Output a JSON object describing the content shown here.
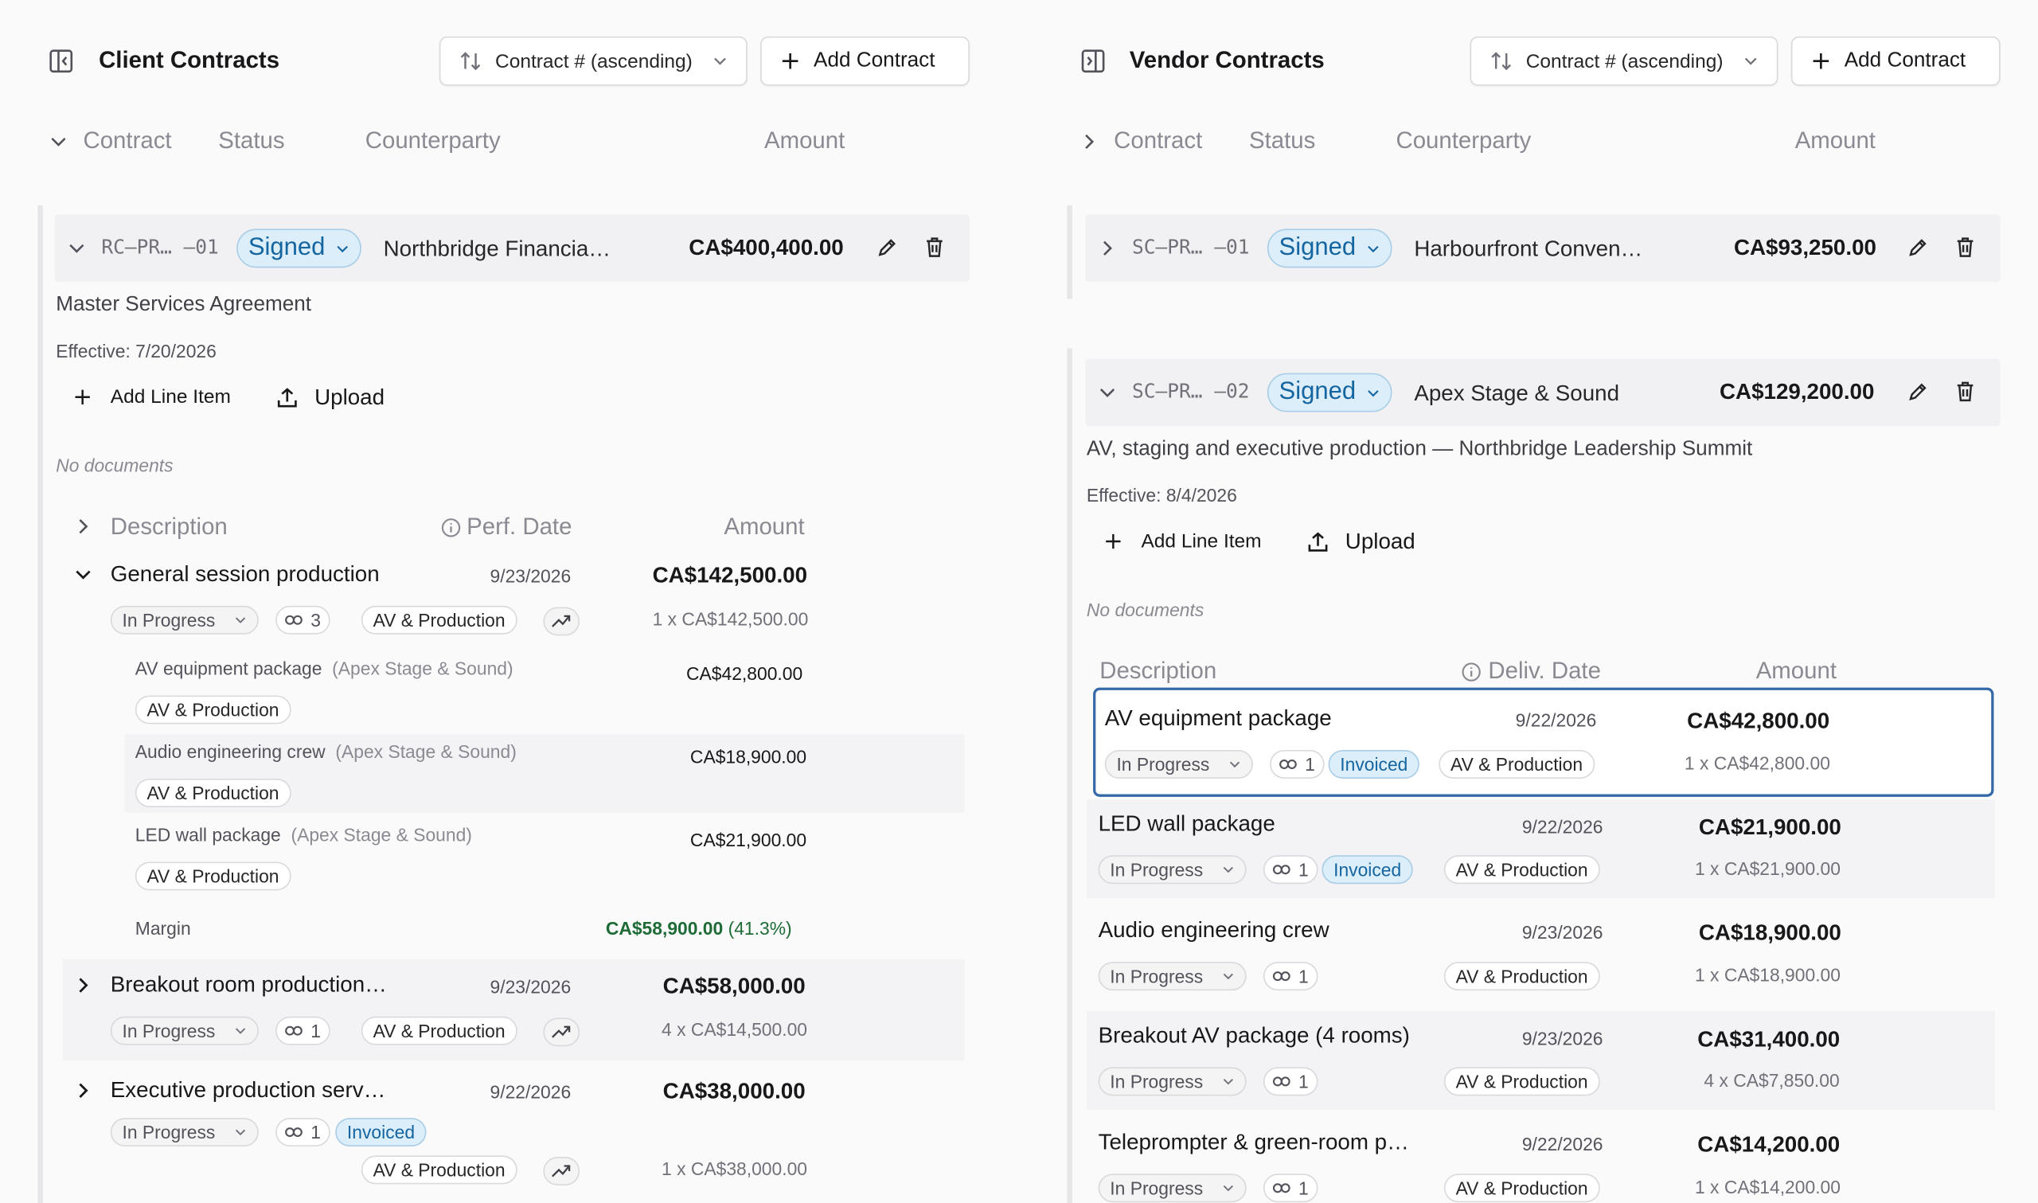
{
  "client": {
    "title": "Client Contracts",
    "sort_label": "Contract # (ascending)",
    "add_label": "Add Contract",
    "columns": {
      "contract": "Contract",
      "status": "Status",
      "counterparty": "Counterparty",
      "amount": "Amount"
    },
    "contract": {
      "number": "RC–PR… –01",
      "status": "Signed",
      "counterparty": "Northbridge Financia…",
      "amount": "CA$400,400.00",
      "description": "Master Services Agreement",
      "effective": "Effective: 7/20/2026",
      "add_line_item": "Add Line Item",
      "upload": "Upload",
      "no_documents": "No documents",
      "li_columns": {
        "description": "Description",
        "date": "Perf. Date",
        "amount": "Amount"
      },
      "line_items": [
        {
          "title": "General session production",
          "date": "9/23/2026",
          "amount": "CA$142,500.00",
          "status": "In Progress",
          "links": "3",
          "category": "AV & Production",
          "qty": "1 x CA$142,500.00",
          "children": [
            {
              "title": "AV equipment package",
              "vendor": "(Apex Stage & Sound)",
              "amount": "CA$42,800.00",
              "category": "AV & Production"
            },
            {
              "title": "Audio engineering crew",
              "vendor": "(Apex Stage & Sound)",
              "amount": "CA$18,900.00",
              "category": "AV & Production"
            },
            {
              "title": "LED wall package",
              "vendor": "(Apex Stage & Sound)",
              "amount": "CA$21,900.00",
              "category": "AV & Production"
            }
          ],
          "margin_label": "Margin",
          "margin_amount": "CA$58,900.00",
          "margin_pct": "(41.3%)"
        },
        {
          "title": "Breakout room production…",
          "date": "9/23/2026",
          "amount": "CA$58,000.00",
          "status": "In Progress",
          "links": "1",
          "category": "AV & Production",
          "qty": "4 x CA$14,500.00"
        },
        {
          "title": "Executive production serv…",
          "date": "9/22/2026",
          "amount": "CA$38,000.00",
          "status": "In Progress",
          "links": "1",
          "invoiced": "Invoiced",
          "category": "AV & Production",
          "qty": "1 x CA$38,000.00"
        }
      ]
    }
  },
  "vendor": {
    "title": "Vendor Contracts",
    "sort_label": "Contract # (ascending)",
    "add_label": "Add Contract",
    "columns": {
      "contract": "Contract",
      "status": "Status",
      "counterparty": "Counterparty",
      "amount": "Amount"
    },
    "contracts": [
      {
        "number": "SC–PR… –01",
        "status": "Signed",
        "counterparty": "Harbourfront Conven…",
        "amount": "CA$93,250.00"
      },
      {
        "number": "SC–PR… –02",
        "status": "Signed",
        "counterparty": "Apex Stage & Sound",
        "amount": "CA$129,200.00",
        "description": "AV, staging and executive production — Northbridge Leadership Summit",
        "effective": "Effective: 8/4/2026",
        "add_line_item": "Add Line Item",
        "upload": "Upload",
        "no_documents": "No documents",
        "li_columns": {
          "description": "Description",
          "date": "Deliv. Date",
          "amount": "Amount"
        },
        "line_items": [
          {
            "title": "AV equipment package",
            "date": "9/22/2026",
            "amount": "CA$42,800.00",
            "status": "In Progress",
            "links": "1",
            "invoiced": "Invoiced",
            "category": "AV & Production",
            "qty": "1 x CA$42,800.00"
          },
          {
            "title": "LED wall package",
            "date": "9/22/2026",
            "amount": "CA$21,900.00",
            "status": "In Progress",
            "links": "1",
            "invoiced": "Invoiced",
            "category": "AV & Production",
            "qty": "1 x CA$21,900.00"
          },
          {
            "title": "Audio engineering crew",
            "date": "9/23/2026",
            "amount": "CA$18,900.00",
            "status": "In Progress",
            "links": "1",
            "category": "AV & Production",
            "qty": "1 x CA$18,900.00"
          },
          {
            "title": "Breakout AV package (4 rooms)",
            "date": "9/23/2026",
            "amount": "CA$31,400.00",
            "status": "In Progress",
            "links": "1",
            "category": "AV & Production",
            "qty": "4 x CA$7,850.00"
          },
          {
            "title": "Teleprompter & green-room p…",
            "date": "9/22/2026",
            "amount": "CA$14,200.00",
            "status": "In Progress",
            "links": "1",
            "category": "AV & Production",
            "qty": "1 x CA$14,200.00"
          }
        ]
      }
    ]
  },
  "colors": {
    "accent": "#1565a0",
    "badge_bg": "#dbeefa",
    "margin_green": "#1f6b37",
    "selection": "#3569a8"
  }
}
